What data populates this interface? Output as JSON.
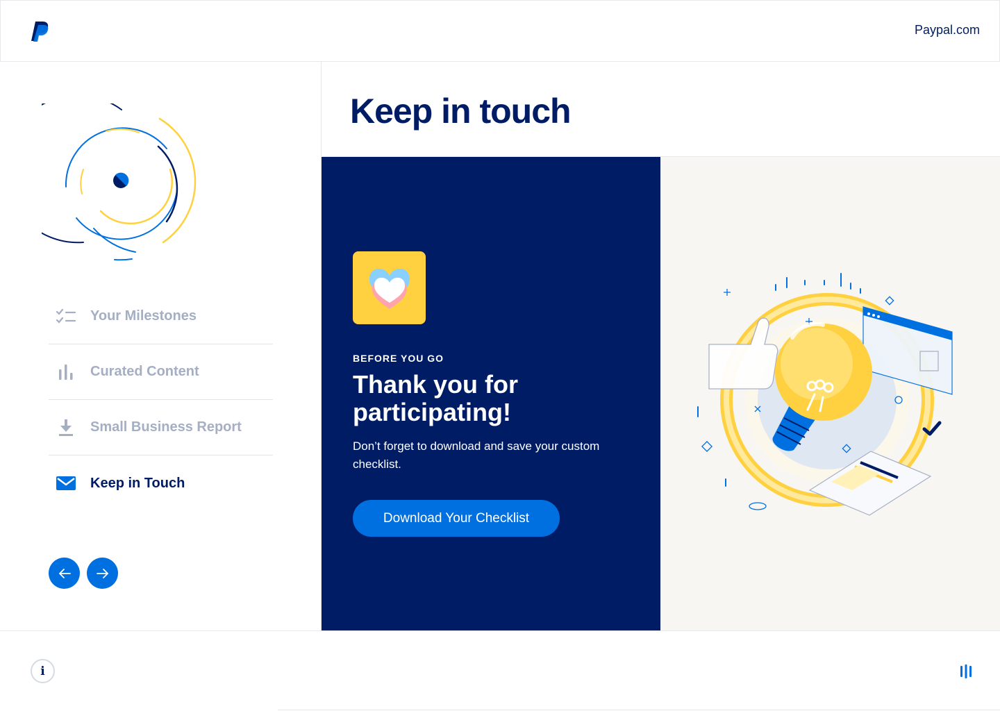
{
  "header": {
    "site_link": "Paypal.com",
    "logo_icon": "paypal-logo-icon"
  },
  "sidebar": {
    "nav_items": [
      {
        "label": "Your Milestones",
        "icon": "checklist-icon",
        "active": false
      },
      {
        "label": "Curated Content",
        "icon": "bar-chart-icon",
        "active": false
      },
      {
        "label": "Small Business Report",
        "icon": "download-icon",
        "active": false
      },
      {
        "label": "Keep in Touch",
        "icon": "envelope-icon",
        "active": true
      }
    ],
    "prev_icon": "arrow-left-icon",
    "next_icon": "arrow-right-icon"
  },
  "main": {
    "title": "Keep in touch",
    "card": {
      "eyebrow": "BEFORE YOU GO",
      "heading": "Thank you for participating!",
      "body": "Don’t forget to download and save your custom checklist.",
      "cta_label": "Download Your Checklist",
      "tile_icon": "heart-icon"
    },
    "illustration": "lightbulb-thumbs-up-illustration"
  },
  "footer": {
    "info_label": "i",
    "menu_icon": "vertical-bars-icon"
  },
  "colors": {
    "navy": "#001c64",
    "blue": "#0070e0",
    "yellow": "#ffd140",
    "muted": "#a5aec3",
    "cream": "#f7f6f3"
  }
}
